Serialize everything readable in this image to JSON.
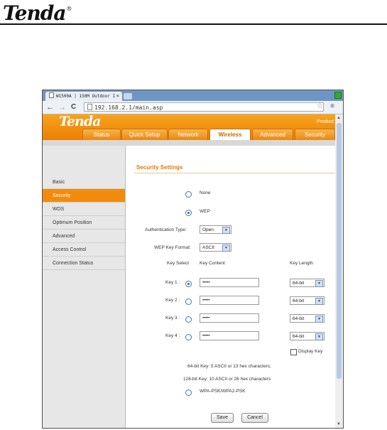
{
  "document": {
    "logo": "Tenda",
    "logo_mark": "®"
  },
  "browser": {
    "tab_title": "W1500A | 150M Outdoor I",
    "tab_close": "×",
    "url": "192.168.2.1/main.asp",
    "back": "←",
    "forward": "→",
    "reload": "C",
    "star": "☆",
    "menu": "≡"
  },
  "router": {
    "brand": "Tenda",
    "brand_sub": "Product",
    "nav_tabs": [
      "Status",
      "Quick Setup",
      "Network",
      "Wireless",
      "Advanced",
      "Security"
    ],
    "active_tab": "Wireless",
    "sidebar": [
      "Basic",
      "Security",
      "WDS",
      "Optimum Position",
      "Advanced",
      "Access Control",
      "Connection Status"
    ],
    "active_sidebar": "Security"
  },
  "security": {
    "title": "Security Settings",
    "opt_none": "None",
    "opt_wep": "WEP",
    "opt_wpa": "WPA-PSK/WPA2-PSK",
    "selected_mode": "WEP",
    "auth_type_label": "Authentication Type:",
    "auth_type_value": "Open",
    "key_format_label": "WEP Key Format:",
    "key_format_value": "ASCII",
    "col_key_select": "Key Select",
    "col_key_content": "Key Content",
    "col_key_length": "Key Length",
    "keys": [
      {
        "label": "Key 1 :",
        "content": "•••••",
        "length": "64-bit",
        "selected": true
      },
      {
        "label": "Key 2 :",
        "content": "•••••",
        "length": "64-bit",
        "selected": false
      },
      {
        "label": "Key 3 :",
        "content": "•••••",
        "length": "64-bit",
        "selected": false
      },
      {
        "label": "Key 4 :",
        "content": "•••••",
        "length": "64-bit",
        "selected": false
      }
    ],
    "display_key": "Display Key",
    "note_64": "64-bit Key: 5 ASCII or 13 hex characters;",
    "note_128": "128-bit Key: 10 ASCII or 26 hex characters",
    "save": "Save",
    "cancel": "Cancel"
  },
  "colors": {
    "accent": "#f28b0d",
    "header": "#ec7e05",
    "title": "#e07b00"
  }
}
